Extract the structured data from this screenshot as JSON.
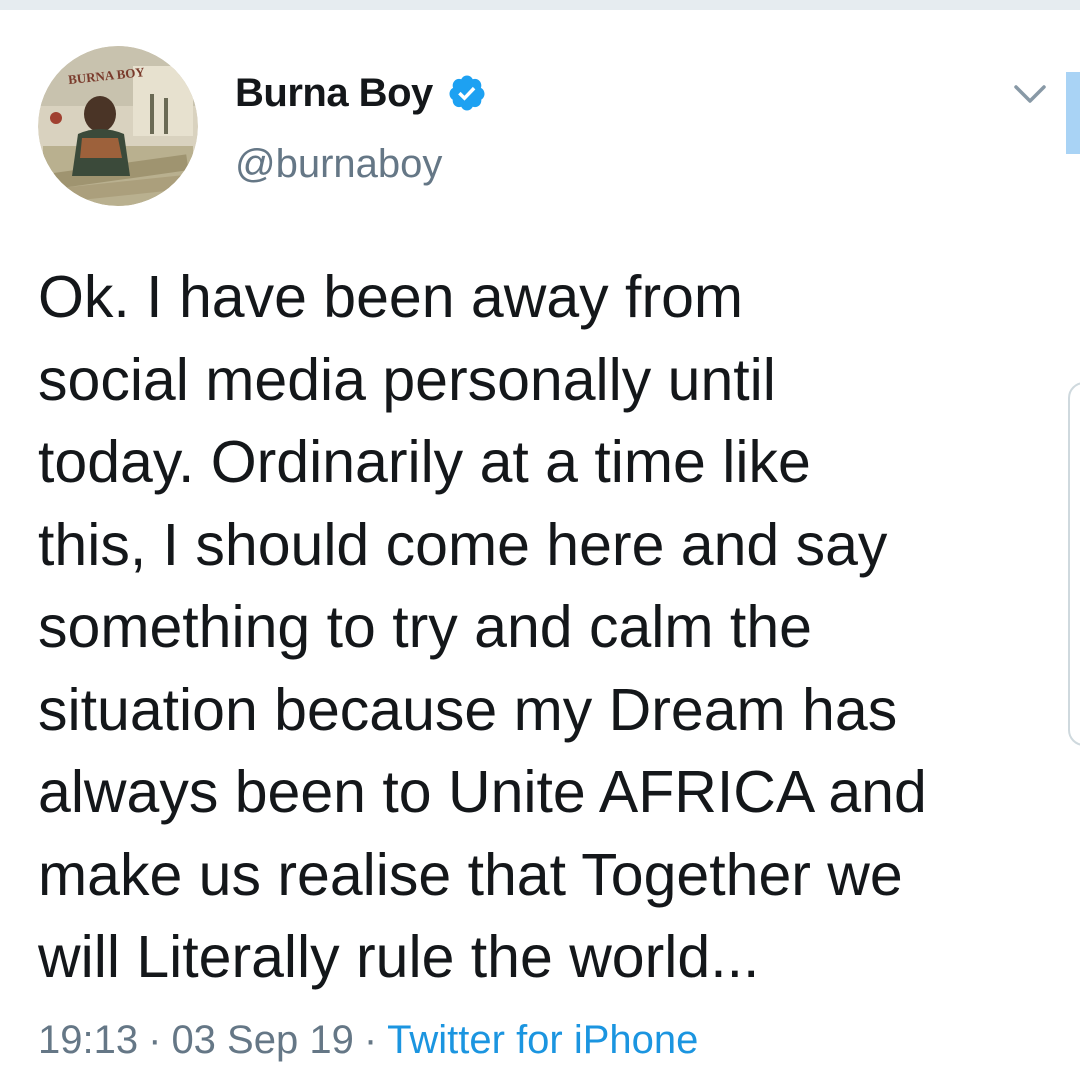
{
  "user": {
    "display_name": "Burna Boy",
    "handle": "@burnaboy",
    "verified": true,
    "verified_icon": "verified-badge-icon",
    "avatar_text": "BURNA BOY"
  },
  "tweet": {
    "lines": [
      "Ok. I have been away from",
      "social media personally until",
      "today. Ordinarily at a time like",
      "this, I should come here and say",
      "something to try and calm the",
      "situation because my Dream has",
      "always been to Unite AFRICA and",
      "make us realise that Together we",
      "will Literally rule the world..."
    ],
    "time": "19:13",
    "date": "03 Sep 19",
    "separator": "·",
    "source": "Twitter for iPhone"
  },
  "icons": {
    "menu_caret": "chevron-down-icon"
  },
  "colors": {
    "text": "#14171a",
    "secondary": "#657786",
    "link": "#1b95e0",
    "verified": "#1da1f2"
  }
}
